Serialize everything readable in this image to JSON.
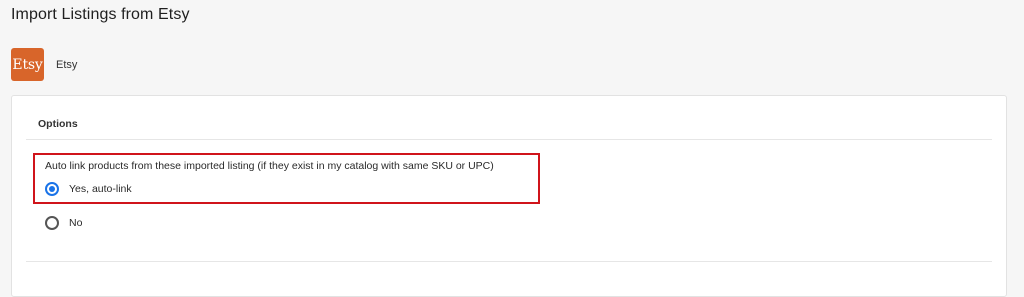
{
  "page": {
    "title": "Import Listings from Etsy"
  },
  "channel": {
    "logo_text": "Etsy",
    "name": "Etsy",
    "logo_color": "#d8652a"
  },
  "options": {
    "section_title": "Options",
    "question": "Auto link products from these imported listing (if they exist in my catalog with same SKU or UPC)",
    "choices": [
      {
        "label": "Yes, auto-link",
        "selected": true
      },
      {
        "label": "No",
        "selected": false
      }
    ],
    "highlight_color": "#d0141b",
    "accent_color": "#1a73e8"
  }
}
